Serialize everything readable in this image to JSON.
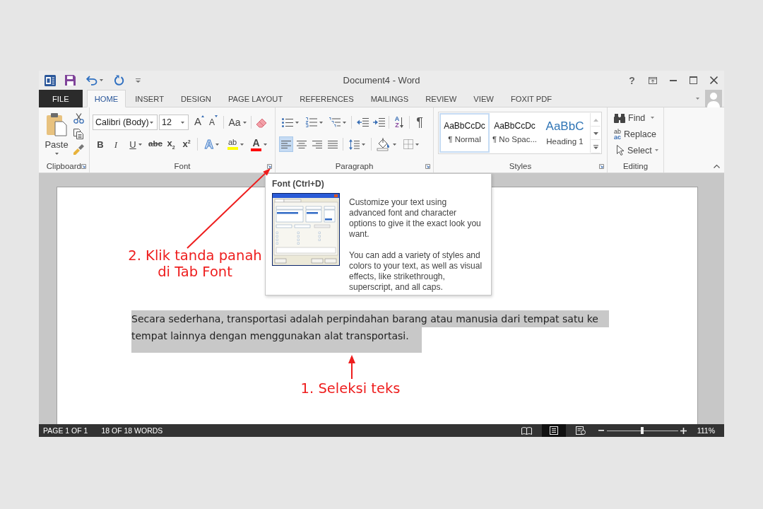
{
  "title_bar": {
    "title": "Document4 - Word",
    "help": "?"
  },
  "ribbon_tabs": [
    {
      "label": "FILE",
      "kind": "file",
      "selected": false
    },
    {
      "label": "HOME",
      "kind": "tab",
      "selected": true
    },
    {
      "label": "INSERT",
      "kind": "tab",
      "selected": false
    },
    {
      "label": "DESIGN",
      "kind": "tab",
      "selected": false
    },
    {
      "label": "PAGE LAYOUT",
      "kind": "tab",
      "selected": false
    },
    {
      "label": "REFERENCES",
      "kind": "tab",
      "selected": false
    },
    {
      "label": "MAILINGS",
      "kind": "tab",
      "selected": false
    },
    {
      "label": "REVIEW",
      "kind": "tab",
      "selected": false
    },
    {
      "label": "VIEW",
      "kind": "tab",
      "selected": false
    },
    {
      "label": "FOXIT PDF",
      "kind": "tab",
      "selected": false
    }
  ],
  "clipboard_group": {
    "paste": "Paste",
    "label": "Clipboard"
  },
  "font_group": {
    "font_name": "Calibri (Body)",
    "font_size": "12",
    "size_buttons": [
      {
        "kind": "grow",
        "glyph": "A"
      },
      {
        "kind": "shrink",
        "glyph": "A"
      }
    ],
    "change_case": "Aa",
    "format_buttons": [
      {
        "kind": "bold",
        "glyph": "B"
      },
      {
        "kind": "italic",
        "glyph": "I"
      },
      {
        "kind": "underline",
        "glyph": "U"
      },
      {
        "kind": "strikethrough",
        "glyph": "abc"
      },
      {
        "kind": "subscript",
        "glyph": "x$_{2}$"
      },
      {
        "kind": "superscript",
        "glyph": "x$^{2}$"
      }
    ],
    "color_buttons": [
      {
        "kind": "effects",
        "glyph": "A"
      },
      {
        "kind": "highlight",
        "glyph": "ab",
        "color": "#ffff00"
      },
      {
        "kind": "font_color",
        "glyph": "A",
        "color": "#ff0000"
      }
    ],
    "label": "Font"
  },
  "paragraph_group": {
    "sort": {
      "top": "A",
      "bottom": "Z"
    },
    "pilcrow": "¶",
    "alignments": [
      {
        "kind": "left",
        "selected": true
      },
      {
        "kind": "center",
        "selected": false
      },
      {
        "kind": "right",
        "selected": false
      },
      {
        "kind": "justify",
        "selected": false
      }
    ],
    "label": "Paragraph"
  },
  "styles_group": {
    "items": [
      {
        "preview": "AaBbCcDc",
        "name": "¶ Normal",
        "kind": "body",
        "selected": true
      },
      {
        "preview": "AaBbCcDc",
        "name": "¶ No Spac...",
        "kind": "body",
        "selected": false
      },
      {
        "preview": "AaBbC",
        "name": "Heading 1",
        "kind": "heading",
        "selected": false
      }
    ],
    "label": "Styles"
  },
  "editing_group": {
    "find": "Find",
    "replace_glyph": {
      "top": "ab",
      "bottom": "ac"
    },
    "replace": "Replace",
    "select": "Select",
    "label": "Editing"
  },
  "tooltip": {
    "title": "Font (Ctrl+D)",
    "paragraphs": [
      "Customize your text using advanced font and character options to give it the exact look you want.",
      "You can add a variety of styles and colors to your text, as well as visual effects, like strikethrough, superscript, and all caps."
    ]
  },
  "document": {
    "paragraph": {
      "text": "Secara sederhana, transportasi adalah perpindahan barang atau manusia dari tempat satu ke tempat lainnya dengan menggunakan alat transportasi.",
      "selected": true
    }
  },
  "annotations": {
    "launcher_note": "2. Klik tanda panah di Tab Font",
    "selection_note": "1. Seleksi teks"
  },
  "status_bar": {
    "page": "PAGE 1 OF 1",
    "words": "18 OF 18 WORDS",
    "views": [
      {
        "kind": "read",
        "selected": false
      },
      {
        "kind": "print",
        "selected": true
      },
      {
        "kind": "web",
        "selected": false
      }
    ],
    "zoom": {
      "level": 0.5,
      "reading": "111%"
    }
  }
}
